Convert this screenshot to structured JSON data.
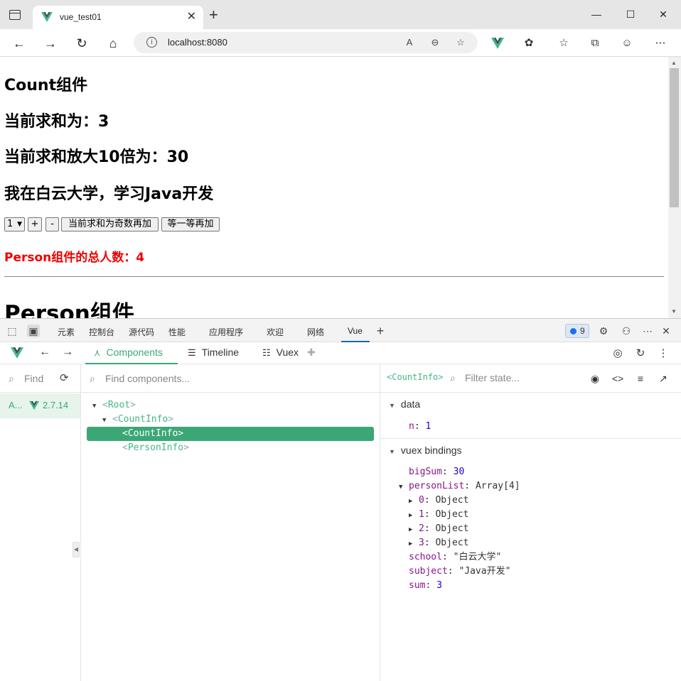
{
  "browser": {
    "tab_title": "vue_test01",
    "url": "localhost:8080",
    "window_controls": [
      "minimize",
      "maximize",
      "close"
    ]
  },
  "page": {
    "count_heading": "Count组件",
    "sum_line": "当前求和为：3",
    "bigsum_line": "当前求和放大10倍为：30",
    "school_line": "我在白云大学，学习Java开发",
    "select_value": "1",
    "btn_plus": "+",
    "btn_minus": "-",
    "btn_odd_add": "当前求和为奇数再加",
    "btn_wait_add": "等一等再加",
    "person_count": "Person组件的总人数：4",
    "person_heading": "Person组件"
  },
  "devtools": {
    "tabs": [
      "元素",
      "控制台",
      "源代码",
      "性能",
      "应用程序",
      "欢迎",
      "网络",
      "Vue"
    ],
    "active_tab": "Vue",
    "issues_count": "9"
  },
  "vue": {
    "tabs": {
      "components": "Components",
      "timeline": "Timeline",
      "vuex": "Vuex"
    },
    "apps_search_placeholder": "Find",
    "app_name": "A...",
    "app_version": "2.7.14",
    "components_search_placeholder": "Find components...",
    "tree": {
      "root": "Root",
      "count_info_parent": "CountInfo",
      "count_info_selected": "CountInfo",
      "person_info": "PersonInfo"
    },
    "state": {
      "selected_tag": "<CountInfo>",
      "filter_placeholder": "Filter state...",
      "data_title": "data",
      "data_n_key": "n",
      "data_n_value": "1",
      "vuex_title": "vuex bindings",
      "bigSum_key": "bigSum",
      "bigSum_value": "30",
      "personList_key": "personList",
      "personList_type": "Array[4]",
      "items": [
        {
          "key": "0",
          "type": "Object"
        },
        {
          "key": "1",
          "type": "Object"
        },
        {
          "key": "2",
          "type": "Object"
        },
        {
          "key": "3",
          "type": "Object"
        }
      ],
      "school_key": "school",
      "school_value": "\"白云大学\"",
      "subject_key": "subject",
      "subject_value": "\"Java开发\"",
      "sum_key": "sum",
      "sum_value": "3"
    }
  },
  "colors": {
    "vue_green": "#3ba776",
    "alert_red": "#ee0000"
  }
}
